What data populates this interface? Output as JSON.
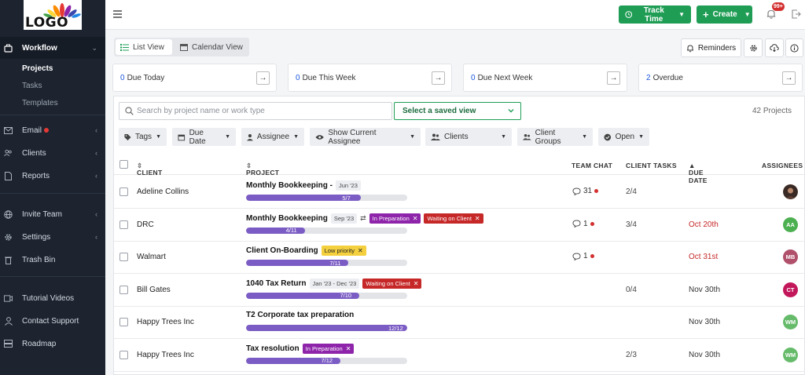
{
  "logo": {
    "text": "LOGO"
  },
  "sidebar": {
    "workflow": {
      "label": "Workflow",
      "subitems": [
        "Projects",
        "Tasks",
        "Templates"
      ]
    },
    "items": [
      {
        "label": "Email",
        "has_dot": true
      },
      {
        "label": "Clients"
      },
      {
        "label": "Reports"
      },
      {
        "label": "Invite Team"
      },
      {
        "label": "Settings"
      },
      {
        "label": "Trash Bin"
      },
      {
        "label": "Tutorial Videos"
      },
      {
        "label": "Contact Support"
      },
      {
        "label": "Roadmap"
      }
    ]
  },
  "topbar": {
    "track_time": "Track Time",
    "create": "Create",
    "notif_badge": "99+"
  },
  "view_toggle": {
    "list": "List View",
    "calendar": "Calendar View"
  },
  "top_actions": {
    "reminders": "Reminders"
  },
  "cards": [
    {
      "count": "0",
      "label": "Due Today"
    },
    {
      "count": "0",
      "label": "Due This Week"
    },
    {
      "count": "0",
      "label": "Due Next Week"
    },
    {
      "count": "2",
      "label": "Overdue"
    }
  ],
  "search": {
    "placeholder": "Search by project name or work type"
  },
  "saved_view": "Select a saved view",
  "project_count": "42 Projects",
  "filters": [
    "Tags",
    "Due Date",
    "Assignee",
    "Show Current Assignee",
    "Clients",
    "Client Groups",
    "Open"
  ],
  "table": {
    "headers": {
      "client": "CLIENT",
      "project": "PROJECT",
      "team_chat": "TEAM CHAT",
      "client_tasks": "CLIENT TASKS",
      "due_date": "DUE DATE",
      "assignees": "ASSIGNEES"
    },
    "rows": [
      {
        "client": "Adeline Collins",
        "project": "Monthly Bookkeeping -",
        "date_tag": "Jun '23",
        "recurring": false,
        "statuses": [],
        "progress_label": "5/7",
        "progress": 0.714,
        "chat": "31",
        "chat_dot": true,
        "client_tasks": "2/4",
        "due": "",
        "due_red": false,
        "avatar": "",
        "avatar_color": "#3b2b2b",
        "photo": true
      },
      {
        "client": "DRC",
        "project": "Monthly Bookkeeping",
        "date_tag": "Sep '23",
        "recurring": true,
        "statuses": [
          {
            "label": "In Preparation",
            "color": "#8e24aa"
          },
          {
            "label": "Waiting on Client",
            "color": "#c62828"
          }
        ],
        "progress_label": "4/11",
        "progress": 0.364,
        "chat": "1",
        "chat_dot": true,
        "client_tasks": "3/4",
        "due": "Oct 20th",
        "due_red": true,
        "avatar": "AA",
        "avatar_color": "#4caf50",
        "photo": false
      },
      {
        "client": "Walmart",
        "project": "Client On-Boarding",
        "date_tag": "",
        "recurring": false,
        "statuses": [
          {
            "label": "Low priority",
            "color": "#f4d03f",
            "dark": true
          }
        ],
        "progress_label": "7/11",
        "progress": 0.636,
        "chat": "1",
        "chat_dot": true,
        "client_tasks": "",
        "due": "Oct 31st",
        "due_red": true,
        "avatar": "MB",
        "avatar_color": "#b0506a",
        "photo": false
      },
      {
        "client": "Bill Gates",
        "project": "1040 Tax Return",
        "date_tag": "Jan '23 - Dec '23",
        "recurring": false,
        "statuses": [
          {
            "label": "Waiting on Client",
            "color": "#c62828"
          }
        ],
        "progress_label": "7/10",
        "progress": 0.7,
        "chat": "",
        "chat_dot": false,
        "client_tasks": "0/4",
        "due": "Nov 30th",
        "due_red": false,
        "avatar": "CT",
        "avatar_color": "#c2185b",
        "photo": false
      },
      {
        "client": "Happy Trees Inc",
        "project": "T2 Corporate tax preparation",
        "date_tag": "",
        "recurring": false,
        "statuses": [],
        "progress_label": "12/12",
        "progress": 1.0,
        "chat": "",
        "chat_dot": false,
        "client_tasks": "",
        "due": "Nov 30th",
        "due_red": false,
        "avatar": "WM",
        "avatar_color": "#66bb6a",
        "photo": false
      },
      {
        "client": "Happy Trees Inc",
        "project": "Tax resolution",
        "date_tag": "",
        "recurring": false,
        "statuses": [
          {
            "label": "In Preparation",
            "color": "#8e24aa"
          }
        ],
        "progress_label": "7/12",
        "progress": 0.583,
        "chat": "",
        "chat_dot": false,
        "client_tasks": "2/3",
        "due": "Nov 30th",
        "due_red": false,
        "avatar": "WM",
        "avatar_color": "#66bb6a",
        "photo": false
      }
    ]
  }
}
